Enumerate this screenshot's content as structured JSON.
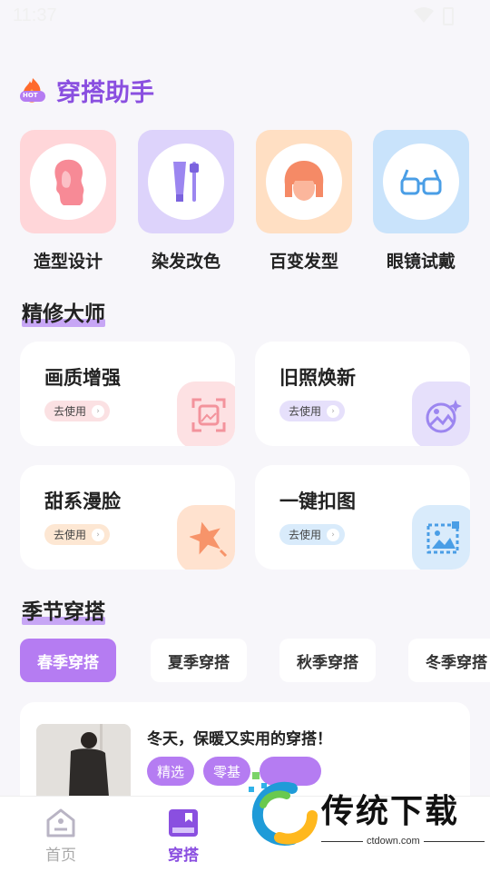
{
  "status": {
    "time": "11:37"
  },
  "header": {
    "title": "穿搭助手",
    "badge": "HOT"
  },
  "tools": [
    {
      "label": "造型设计",
      "color": "#ffd6d9",
      "icon": "hair-silhouette-icon"
    },
    {
      "label": "染发改色",
      "color": "#ddd3fb",
      "icon": "hair-dye-tube-icon"
    },
    {
      "label": "百变发型",
      "color": "#ffdfc3",
      "icon": "hairstyle-icon"
    },
    {
      "label": "眼镜试戴",
      "color": "#c9e3fb",
      "icon": "glasses-icon"
    }
  ],
  "sections": {
    "master": "精修大师",
    "season": "季节穿搭"
  },
  "features": [
    {
      "title": "画质增强",
      "button": "去使用",
      "btn_color": "#fbe1e3",
      "icon_bg": "#fde1e3",
      "icon": "image-enhance-icon"
    },
    {
      "title": "旧照焕新",
      "button": "去使用",
      "btn_color": "#e6e0fb",
      "icon_bg": "#e6e0fb",
      "icon": "photo-restore-icon"
    },
    {
      "title": "甜系漫脸",
      "button": "去使用",
      "btn_color": "#fde7d3",
      "icon_bg": "#ffe2cf",
      "icon": "star-icon"
    },
    {
      "title": "一键扣图",
      "button": "去使用",
      "btn_color": "#d9ebfb",
      "icon_bg": "#d9ebfb",
      "icon": "cutout-icon"
    }
  ],
  "season_tabs": [
    {
      "label": "春季穿搭",
      "active": true
    },
    {
      "label": "夏季穿搭",
      "active": false
    },
    {
      "label": "秋季穿搭",
      "active": false
    },
    {
      "label": "冬季穿搭",
      "active": false
    }
  ],
  "outfit": {
    "title": "冬天，保暖又实用的穿搭！",
    "tags": [
      "精选",
      "零基",
      ""
    ]
  },
  "nav": [
    {
      "label": "首页",
      "active": false
    },
    {
      "label": "穿搭",
      "active": true
    }
  ],
  "watermark": {
    "text": "传统下载",
    "url": "ctdown.com"
  },
  "colors": {
    "accent": "#8a4fe0",
    "tab_active": "#b57cf2"
  }
}
